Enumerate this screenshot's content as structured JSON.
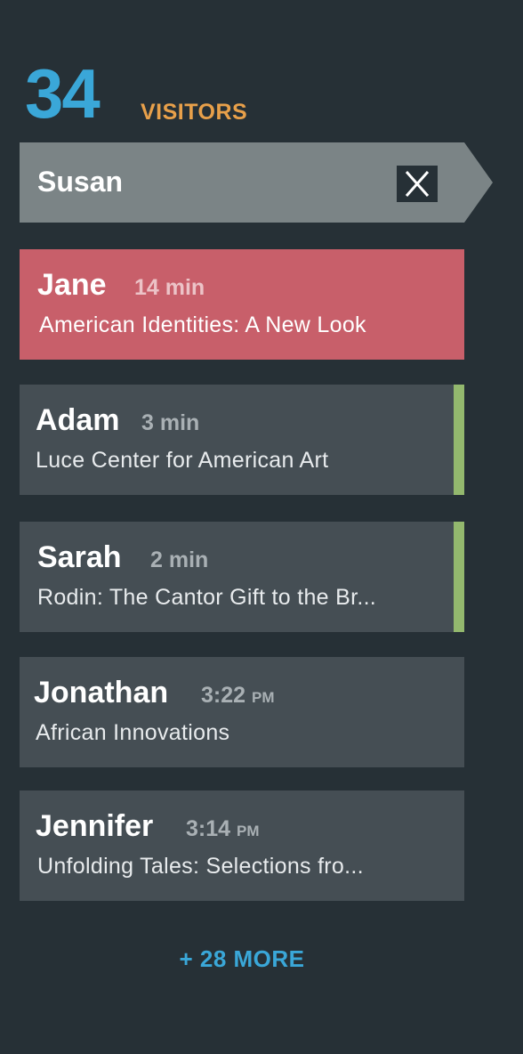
{
  "header": {
    "count": "34",
    "label": "VISITORS"
  },
  "search": {
    "value": "Susan",
    "clear_icon": "close-icon"
  },
  "visitors": [
    {
      "name": "Jane",
      "time": "14 min",
      "ampm": "",
      "exhibit": "American Identities: A New Look",
      "state": "active"
    },
    {
      "name": "Adam",
      "time": "3 min",
      "ampm": "",
      "exhibit": "Luce Center for American Art",
      "state": "new"
    },
    {
      "name": "Sarah",
      "time": "2 min",
      "ampm": "",
      "exhibit": "Rodin: The Cantor Gift to the Br...",
      "state": "new"
    },
    {
      "name": "Jonathan",
      "time": "3:22",
      "ampm": "PM",
      "exhibit": "African Innovations",
      "state": "default"
    },
    {
      "name": "Jennifer",
      "time": "3:14",
      "ampm": "PM",
      "exhibit": "Unfolding Tales: Selections fro...",
      "state": "default"
    }
  ],
  "more": {
    "label": "+ 28 MORE"
  },
  "colors": {
    "background": "#263036",
    "accent_blue": "#3aa7d8",
    "accent_orange": "#e8a04a",
    "active_card": "#c85f6a",
    "card": "#454e54",
    "new_indicator": "#93b86e",
    "search_bar": "#7b8486"
  }
}
